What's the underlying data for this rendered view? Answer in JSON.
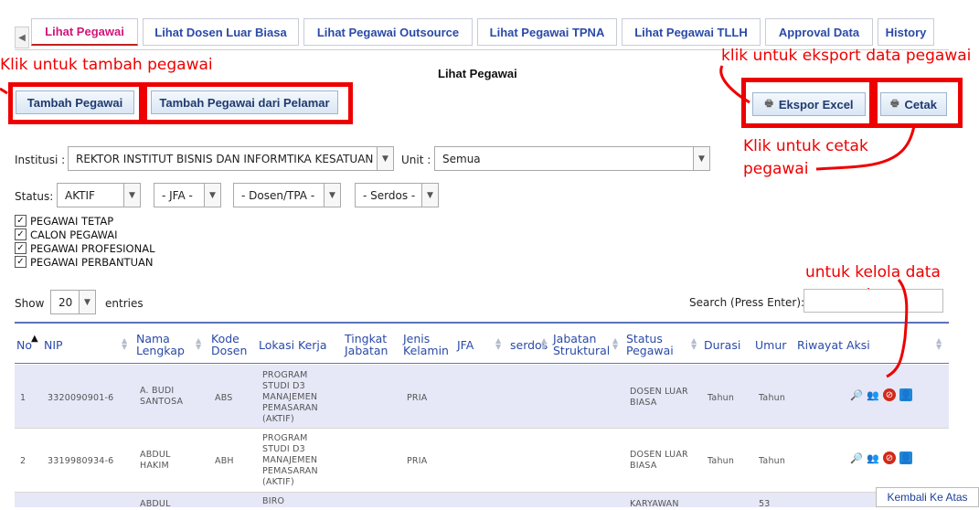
{
  "tabs": [
    "Lihat Pegawai",
    "Lihat Dosen Luar Biasa",
    "Lihat Pegawai Outsource",
    "Lihat Pegawai TPNA",
    "Lihat Pegawai TLLH",
    "Approval Data",
    "History"
  ],
  "page_title": "Lihat Pegawai",
  "buttons": {
    "tambah": "Tambah Pegawai",
    "tambah_pelamar": "Tambah Pegawai dari Pelamar",
    "ekspor": "Ekspor Excel",
    "cetak": "Cetak"
  },
  "annotations": {
    "tambah": "Klik untuk tambah pegawai",
    "ekspor": "klik untuk eksport data pegawai",
    "cetak_1": "Klik untuk cetak",
    "cetak_2": "pegawai",
    "kelola_1": "untuk kelola data",
    "kelola_2": "pegawai"
  },
  "filters": {
    "institusi_label": "Institusi :",
    "institusi_value": "REKTOR INSTITUT BISNIS DAN INFORMTIKA KESATUAN",
    "unit_label": "Unit :",
    "unit_value": "Semua",
    "status_label": "Status:",
    "status_value": "AKTIF",
    "jfa_value": "- JFA -",
    "dosen_value": "- Dosen/TPA -",
    "serdos_value": "- Serdos -"
  },
  "checkboxes": [
    "PEGAWAI TETAP",
    "CALON PEGAWAI",
    "PEGAWAI PROFESIONAL",
    "PEGAWAI PERBANTUAN"
  ],
  "show": {
    "label": "Show",
    "value": "20",
    "suffix": "entries"
  },
  "search_label": "Search (Press Enter):",
  "columns": [
    "No",
    "NIP",
    "Nama Lengkap",
    "Kode Dosen",
    "Lokasi Kerja",
    "Tingkat Jabatan",
    "Jenis Kelamin",
    "JFA",
    "serdos",
    "Jabatan Struktural",
    "Status Pegawai",
    "Durasi",
    "Umur",
    "Riwayat",
    "Aksi"
  ],
  "rows": [
    {
      "no": "1",
      "nip": "3320090901-6",
      "nama": [
        "A. BUDI",
        "SANTOSA"
      ],
      "kode": "ABS",
      "lokasi": [
        "PROGRAM",
        "STUDI D3",
        "MANAJEMEN",
        "PEMASARAN",
        "(AKTIF)"
      ],
      "jk": "PRIA",
      "status": [
        "DOSEN LUAR",
        "BIASA"
      ],
      "durasi": "Tahun",
      "umur": "Tahun"
    },
    {
      "no": "2",
      "nip": "3319980934-6",
      "nama": [
        "ABDUL",
        "HAKIM"
      ],
      "kode": "ABH",
      "lokasi": [
        "PROGRAM",
        "STUDI D3",
        "MANAJEMEN",
        "PEMASARAN",
        "(AKTIF)"
      ],
      "jk": "PRIA",
      "status": [
        "DOSEN LUAR",
        "BIASA"
      ],
      "durasi": "Tahun",
      "umur": "Tahun"
    },
    {
      "no": "",
      "nip": "",
      "nama": [
        "ABDUL",
        ""
      ],
      "kode": "",
      "lokasi": [
        "BIRO",
        ""
      ],
      "jk": "",
      "status": [
        "KARYAWAN",
        ""
      ],
      "durasi": "",
      "umur": "53"
    }
  ],
  "back_to_top": "Kembali Ke Atas",
  "colors": {
    "tab_active": "#d2157a",
    "link": "#2a4aa8",
    "annotation": "#e00000",
    "row_highlight": "#e6e8f7"
  }
}
